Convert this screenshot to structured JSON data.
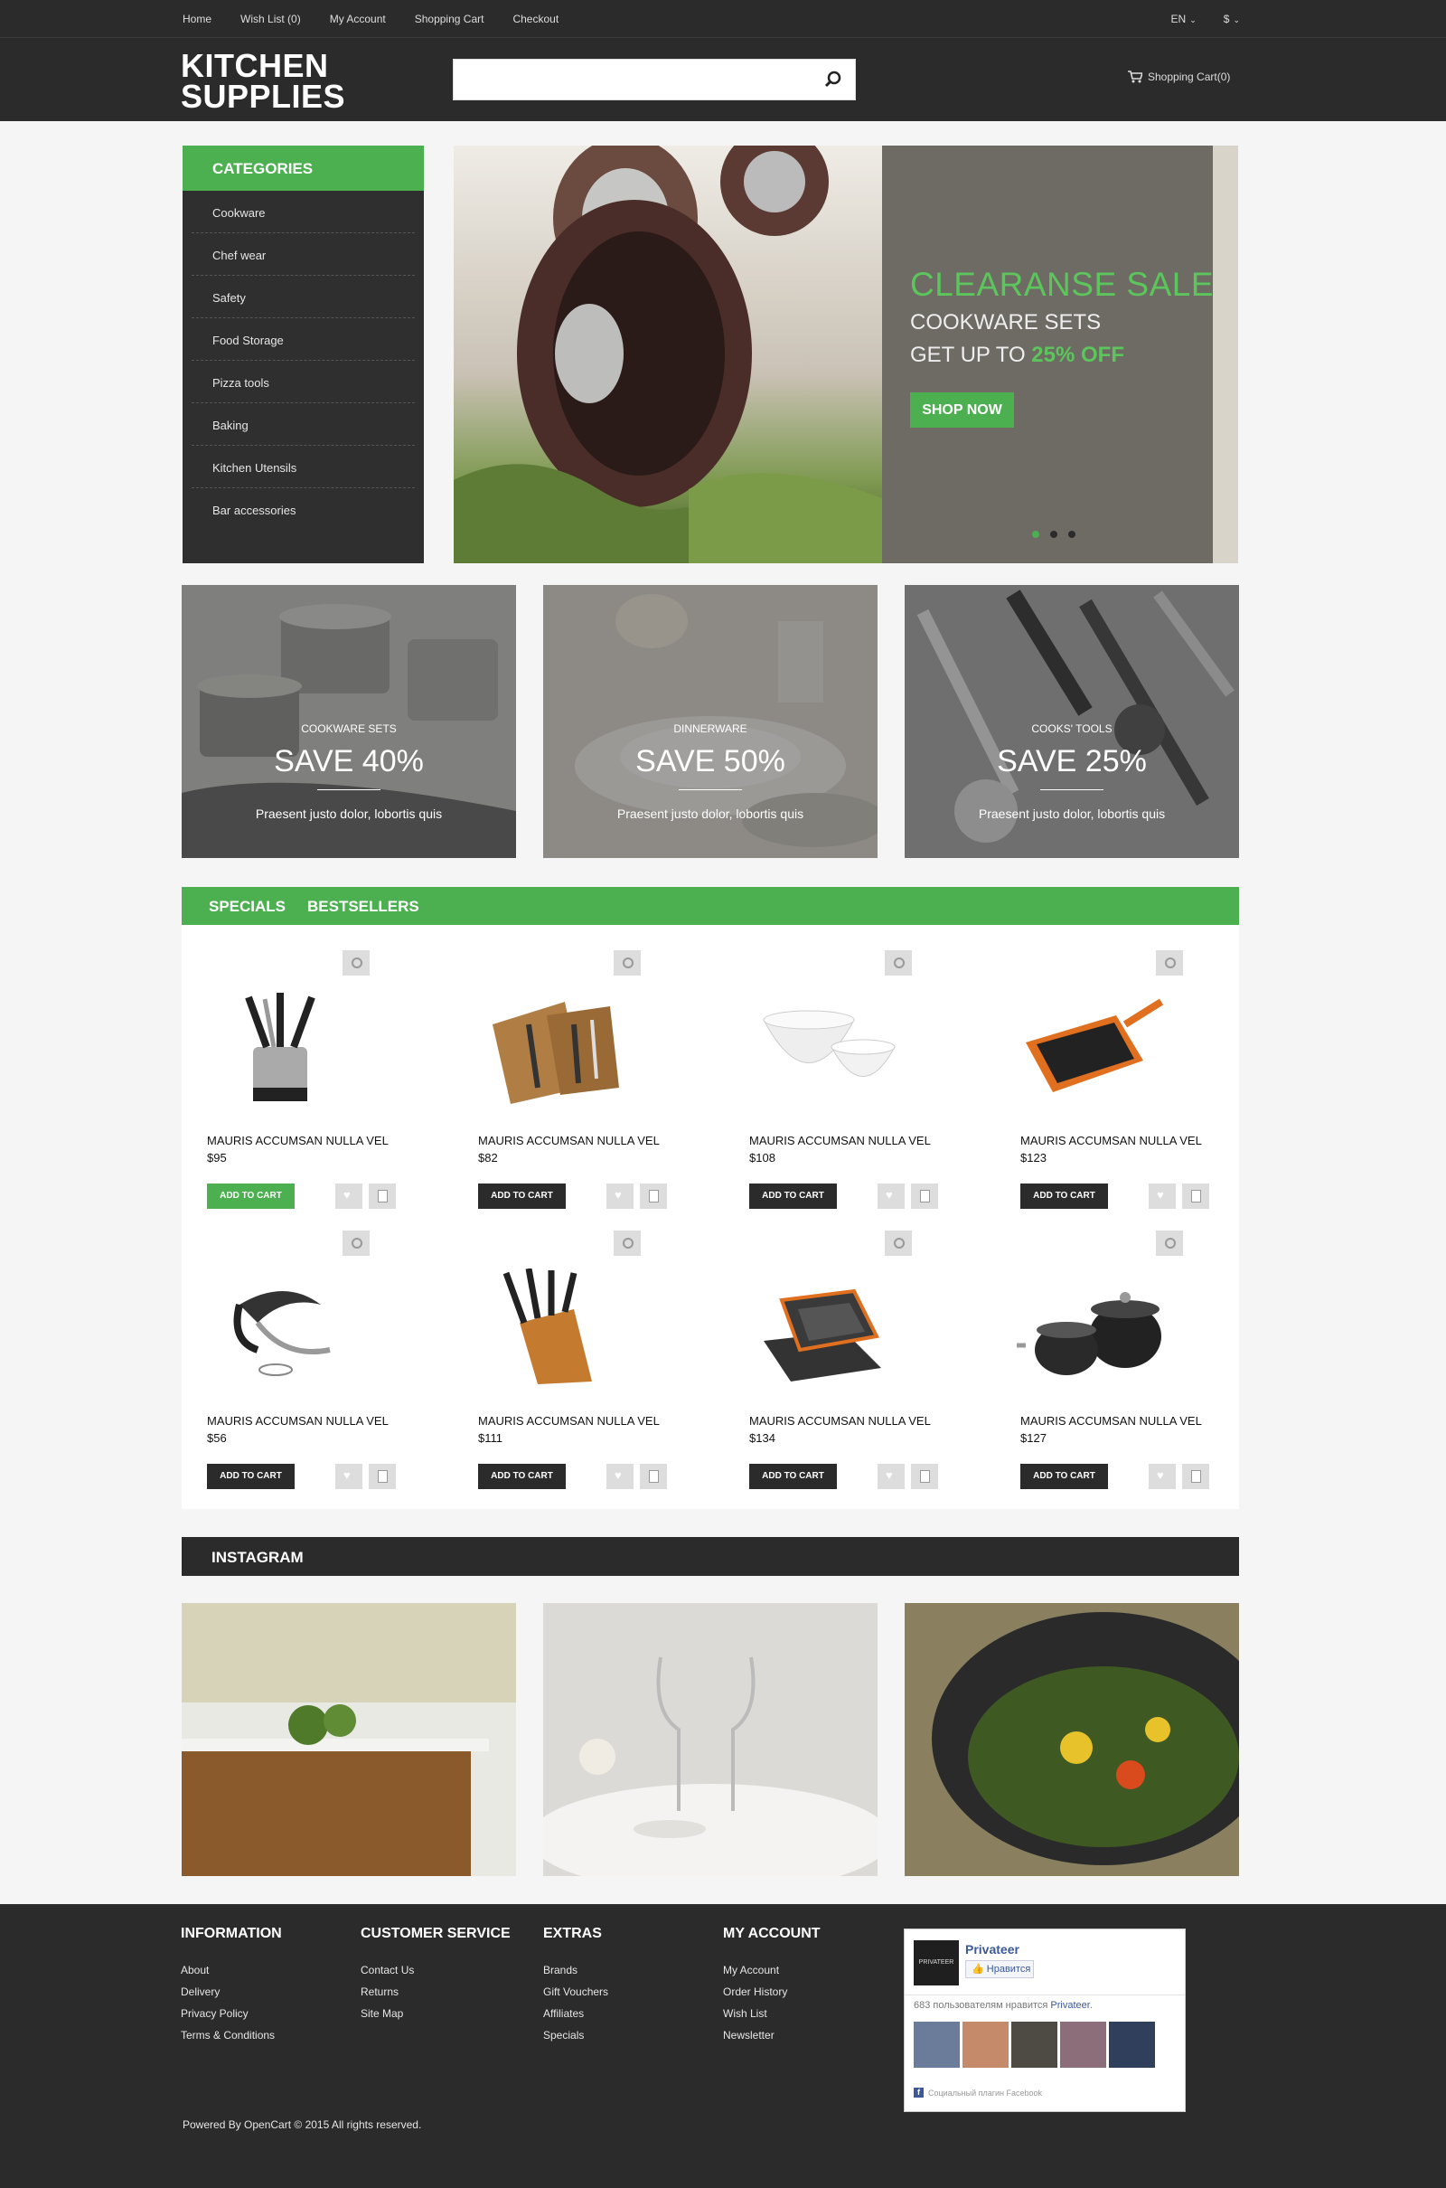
{
  "topbar": {
    "nav": [
      "Home",
      "Wish List (0)",
      "My Account",
      "Shopping Cart",
      "Checkout"
    ],
    "language": "EN",
    "currency": "$"
  },
  "header": {
    "logo_line1": "KITCHEN",
    "logo_line2": "SUPPLIES",
    "search_placeholder": "",
    "cart_label": "Shopping Cart(0)"
  },
  "categories": {
    "title": "CATEGORIES",
    "items": [
      "Cookware",
      "Chef wear",
      "Safety",
      "Food Storage",
      "Pizza tools",
      "Baking",
      "Kitchen Utensils",
      "Bar accessories"
    ]
  },
  "hero": {
    "title": "CLEARANSE SALE",
    "line1": "COOKWARE SETS",
    "line2_prefix": "GET UP TO ",
    "line2_highlight": "25% OFF",
    "button": "SHOP NOW",
    "slide_count": 3,
    "active_slide": 1
  },
  "banners": [
    {
      "label": "COOKWARE SETS",
      "save": "SAVE 40%",
      "desc": "Praesent justo dolor, lobortis quis"
    },
    {
      "label": "DINNERWARE",
      "save": "SAVE 50%",
      "desc": "Praesent justo dolor, lobortis quis"
    },
    {
      "label": "COOKS' TOOLS",
      "save": "SAVE 25%",
      "desc": "Praesent justo dolor, lobortis quis"
    }
  ],
  "tabs": [
    "SPECIALS",
    "BESTSELLERS"
  ],
  "products": [
    {
      "name": "MAURIS ACCUMSAN NULLA VEL",
      "price": "$95",
      "button": "ADD TO CART",
      "icon": "utensil-holder"
    },
    {
      "name": "MAURIS ACCUMSAN NULLA VEL",
      "price": "$82",
      "button": "ADD TO CART",
      "icon": "cutlery-tray"
    },
    {
      "name": "MAURIS ACCUMSAN NULLA VEL",
      "price": "$108",
      "button": "ADD TO CART",
      "icon": "mixing-bowls"
    },
    {
      "name": "MAURIS ACCUMSAN NULLA VEL",
      "price": "$123",
      "button": "ADD TO CART",
      "icon": "grill-pan"
    },
    {
      "name": "MAURIS ACCUMSAN NULLA VEL",
      "price": "$56",
      "button": "ADD TO CART",
      "icon": "corkscrew"
    },
    {
      "name": "MAURIS ACCUMSAN NULLA VEL",
      "price": "$111",
      "button": "ADD TO CART",
      "icon": "knife-block"
    },
    {
      "name": "MAURIS ACCUMSAN NULLA VEL",
      "price": "$134",
      "button": "ADD TO CART",
      "icon": "bakeware-set"
    },
    {
      "name": "MAURIS ACCUMSAN NULLA VEL",
      "price": "$127",
      "button": "ADD TO CART",
      "icon": "pot-set"
    }
  ],
  "instagram": {
    "title": "INSTAGRAM"
  },
  "footer": {
    "columns": [
      {
        "title": "INFORMATION",
        "links": [
          "About",
          "Delivery",
          "Privacy Policy",
          "Terms & Conditions"
        ]
      },
      {
        "title": "CUSTOMER SERVICE",
        "links": [
          "Contact Us",
          "Returns",
          "Site Map"
        ]
      },
      {
        "title": "EXTRAS",
        "links": [
          "Brands",
          "Gift Vouchers",
          "Affiliates",
          "Specials"
        ]
      },
      {
        "title": "MY ACCOUNT",
        "links": [
          "My Account",
          "Order History",
          "Wish List",
          "Newsletter"
        ]
      }
    ],
    "copyright": "Powered By OpenCart © 2015 All rights reserved.",
    "facebook": {
      "page_name": "Privateer",
      "logo_text": "PRIVATEER",
      "like_button": "Нравится",
      "likes_text": "683 пользователям нравится",
      "likes_page": "Privateer",
      "plugin_text": "Социальный плагин Facebook"
    }
  },
  "colors": {
    "accent": "#4caf50",
    "dark": "#2b2b2b"
  }
}
